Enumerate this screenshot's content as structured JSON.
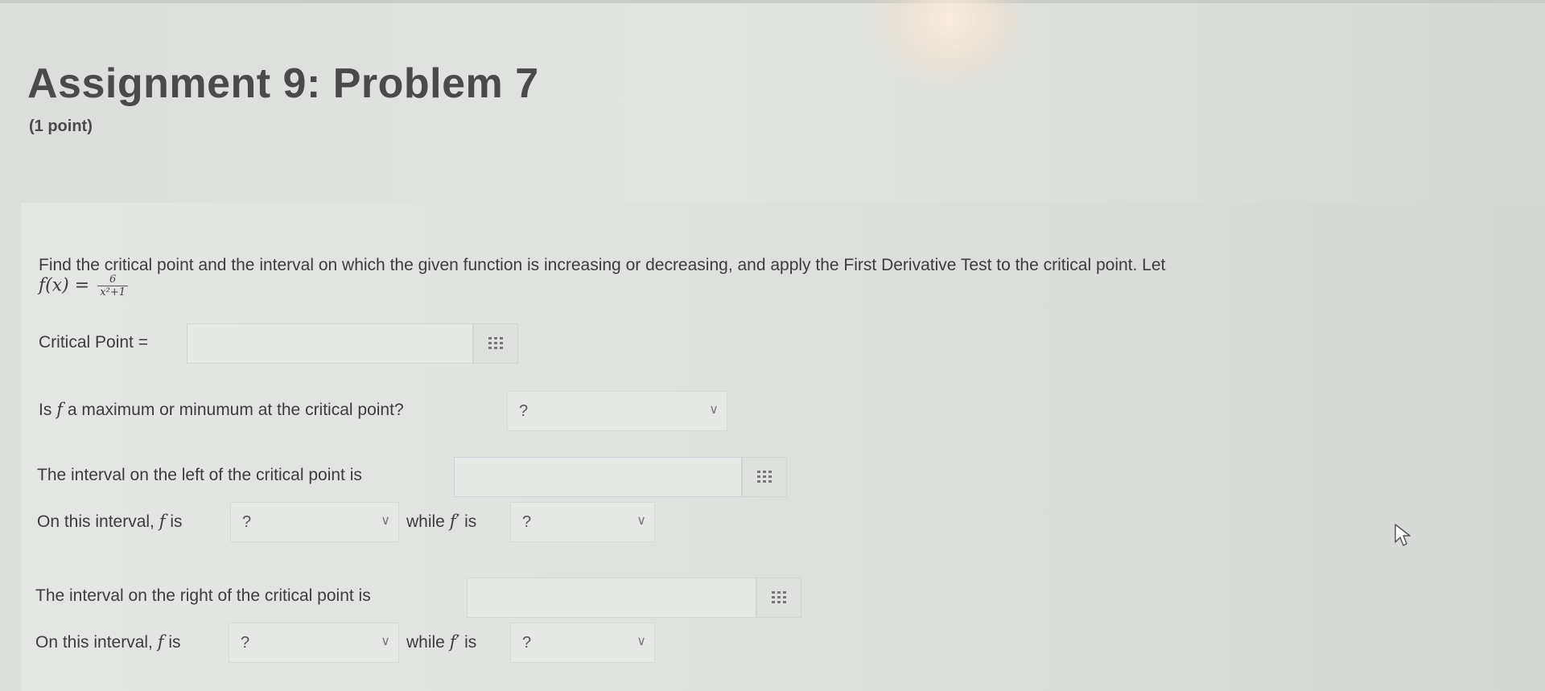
{
  "header": {
    "title": "Assignment 9: Problem 7",
    "points": "(1 point)"
  },
  "problem": {
    "statement": "Find the critical point and the interval on which the given function is increasing or decreasing, and apply the First Derivative Test to the critical point. Let",
    "function_lhs": "f(x) =",
    "function_num": "6",
    "function_den": "x²+1"
  },
  "critical_point": {
    "label": "Critical Point =",
    "value": ""
  },
  "max_min": {
    "label_prefix": "Is",
    "label_f": "f",
    "label_suffix": "a maximum or minumum at the critical point?",
    "selected": "?"
  },
  "left_interval": {
    "label": "The interval on the left of the critical point is",
    "value": "",
    "on_interval_label": "On this interval,",
    "f_sym": "f",
    "is_label": "is",
    "f_state": "?",
    "while_label": "while",
    "fprime_sym": "f′",
    "fprime_state": "?"
  },
  "right_interval": {
    "label": "The interval on the right of the critical point is",
    "value": "",
    "on_interval_label": "On this interval,",
    "f_sym": "f",
    "is_label": "is",
    "f_state": "?",
    "while_label": "while",
    "fprime_sym": "f′",
    "fprime_state": "?"
  },
  "icons": {
    "matrix": "matrix-grid-icon",
    "dropdown": "chevron-down-icon",
    "cursor": "mouse-pointer-icon"
  }
}
